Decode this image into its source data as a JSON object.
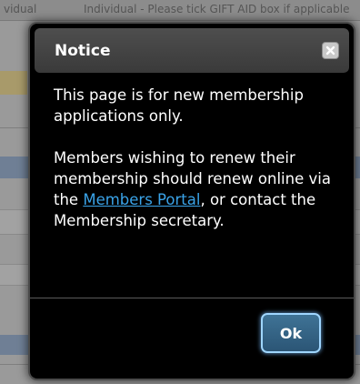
{
  "background": {
    "top_text_left": "vidual",
    "top_text_main": "Individual - Please tick GIFT AID box if applicable"
  },
  "modal": {
    "title": "Notice",
    "close_icon": "close-icon",
    "body": {
      "paragraph_1": "This page is for new membership applications only.",
      "paragraph_2_before_link": "Members wishing to renew their membership should renew online via the ",
      "paragraph_2_link": "Members Portal",
      "paragraph_2_after_link": ", or contact the Membership secretary."
    },
    "ok_label": "Ok"
  },
  "colors": {
    "link": "#3aa3e8",
    "ok_button": "#2f5f80",
    "modal_background": "#000000",
    "header_background": "#444444"
  }
}
